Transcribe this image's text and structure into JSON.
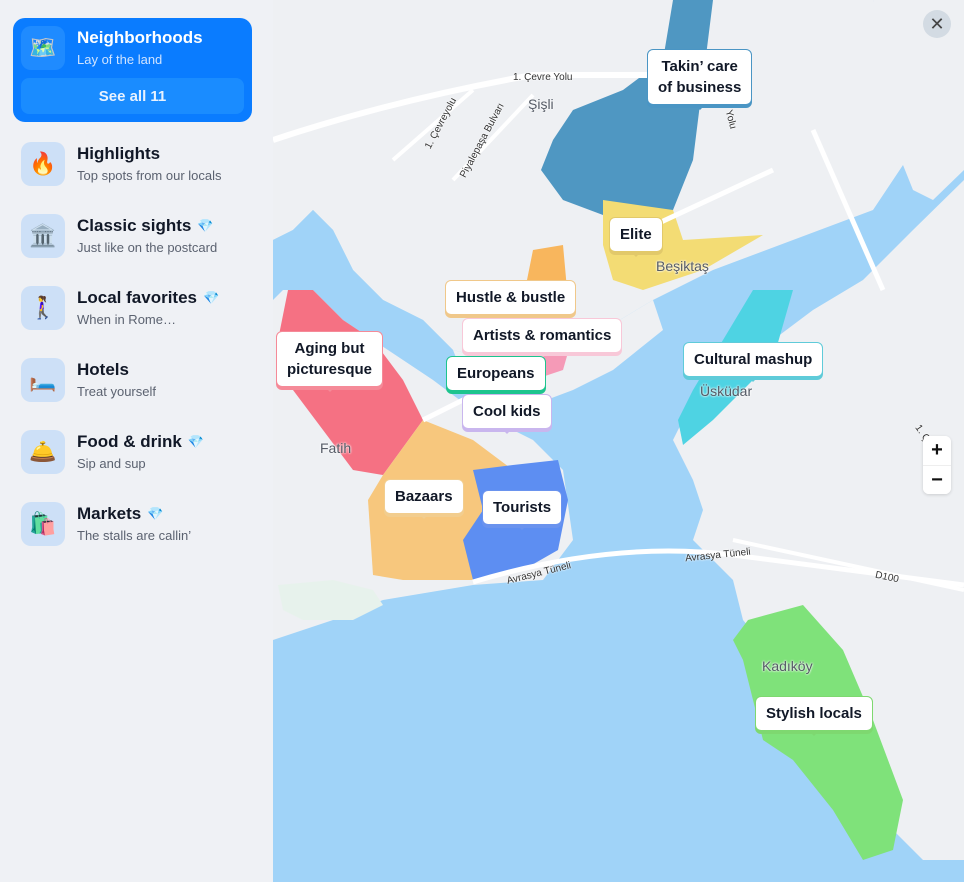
{
  "sidebar": {
    "active": {
      "icon": "world-map-icon",
      "icon_glyph": "🗺️",
      "title": "Neighborhoods",
      "subtitle": "Lay of the land",
      "see_all_label": "See all 11"
    },
    "items": [
      {
        "icon": "fire-icon",
        "icon_glyph": "🔥",
        "title": "Highlights",
        "subtitle": "Top spots from our locals",
        "premium": false
      },
      {
        "icon": "classical-building-icon",
        "icon_glyph": "🏛️",
        "title": "Classic sights",
        "subtitle": "Just like on the postcard",
        "premium": true
      },
      {
        "icon": "person-walking-icon",
        "icon_glyph": "🚶‍♀️",
        "title": "Local favorites",
        "subtitle": "When in Rome…",
        "premium": true
      },
      {
        "icon": "bed-icon",
        "icon_glyph": "🛏️",
        "title": "Hotels",
        "subtitle": "Treat yourself",
        "premium": false
      },
      {
        "icon": "bell-cloche-icon",
        "icon_glyph": "🛎️",
        "title": "Food & drink",
        "subtitle": "Sip and sup",
        "premium": true
      },
      {
        "icon": "shopping-bags-icon",
        "icon_glyph": "🛍️",
        "title": "Markets",
        "subtitle": "The stalls are callin’",
        "premium": true
      }
    ],
    "premium_glyph": "💎"
  },
  "map": {
    "close_glyph": "✕",
    "zoom_in": "+",
    "zoom_out": "−",
    "places": [
      "Şişli",
      "Beşiktaş",
      "Fatih",
      "Üsküdar",
      "Kadıköy"
    ],
    "roads": [
      "1. Çevre Yolu",
      "1. Çevreyolu",
      "Piyalepaşa Bulvarı",
      "Yolu",
      "Avrasya Tüneli",
      "Avrasya Tüneli",
      "D100",
      "1. Ç"
    ],
    "neighborhoods": [
      {
        "label": "Takin’ care of business",
        "line1": "Takin’ care",
        "line2": "of business",
        "color": "#4a95c4"
      },
      {
        "label": "Elite",
        "color": "#e2c96a"
      },
      {
        "label": "Hustle & bustle",
        "color": "#f0c88a"
      },
      {
        "label": "Artists & romantics",
        "color": "#f8c8d8"
      },
      {
        "label": "Aging but picturesque",
        "line1": "Aging but",
        "line2": "picturesque",
        "color": "#f58a98"
      },
      {
        "label": "Europeans",
        "color": "#1dc48e"
      },
      {
        "label": "Cool kids",
        "color": "#c9b6ee"
      },
      {
        "label": "Cultural mashup",
        "color": "#5fcbd9"
      },
      {
        "label": "Bazaars",
        "color": "#f2cd8e"
      },
      {
        "label": "Tourists",
        "color": "#6a93ee"
      },
      {
        "label": "Stylish locals",
        "color": "#7ed870"
      }
    ],
    "area_colors": {
      "water": "#a0d3f8",
      "land": "#eef0f3",
      "business": "#4f97c2",
      "elite": "#f3dc74",
      "aging": "#f57183",
      "bazaars": "#f7c77d",
      "tourists": "#5d8ef2",
      "artists": "#f59ab7",
      "hustle": "#f8b65d",
      "cultural": "#4ed3e3",
      "stylish": "#7fe27a"
    }
  }
}
